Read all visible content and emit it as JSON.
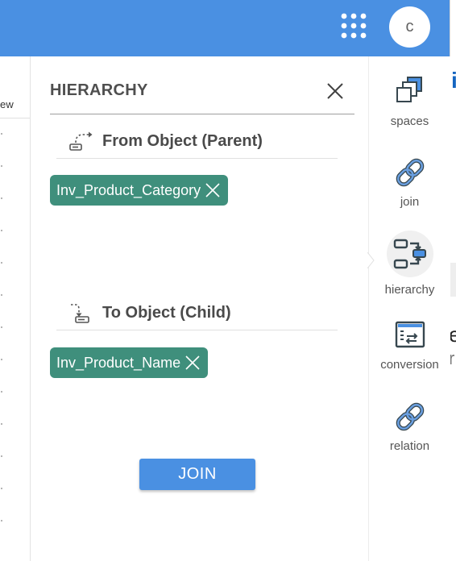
{
  "header": {
    "avatar_initial": "c",
    "icons": {
      "apps": "apps-grid-icon"
    },
    "color": "#4a90e2"
  },
  "background_list": {
    "column_header_fragment": "ew"
  },
  "panel": {
    "title": "HIERARCHY",
    "from_section": {
      "label": "From Object (Parent)",
      "icon": "from-parent-icon",
      "chip": {
        "label": "Inv_Product_Category"
      }
    },
    "to_section": {
      "label": "To Object (Child)",
      "icon": "to-child-icon",
      "chip": {
        "label": "Inv_Product_Name"
      }
    },
    "join_label": "JOIN",
    "chip_color": "#3f8f7c",
    "button_color": "#4a90e2"
  },
  "rail": {
    "items": [
      {
        "label": "spaces",
        "icon": "spaces-icon"
      },
      {
        "label": "join",
        "icon": "link-icon"
      },
      {
        "label": "hierarchy",
        "icon": "hierarchy-icon",
        "active": true
      },
      {
        "label": "conversion",
        "icon": "conversion-icon"
      },
      {
        "label": "relation",
        "icon": "link-icon"
      }
    ]
  }
}
